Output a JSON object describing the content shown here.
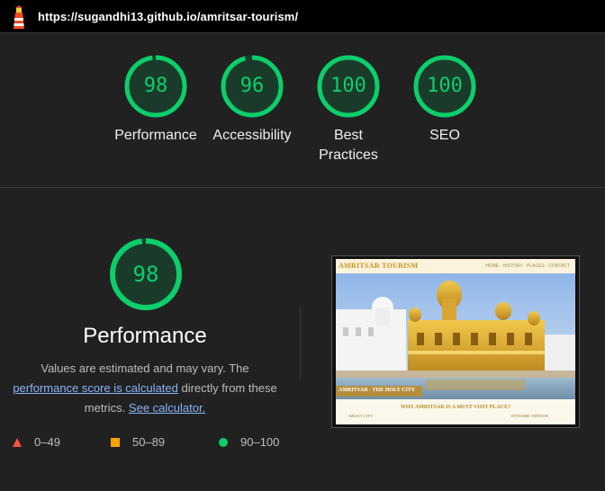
{
  "topbar": {
    "url": "https://sugandhi13.github.io/amritsar-tourism/",
    "logo_icon": "lighthouse-icon"
  },
  "summary": [
    {
      "score": "98",
      "label": "Performance",
      "value": 98
    },
    {
      "score": "96",
      "label": "Accessibility",
      "value": 96
    },
    {
      "score": "100",
      "label": "Best Practices",
      "value": 100
    },
    {
      "score": "100",
      "label": "SEO",
      "value": 100
    }
  ],
  "performance": {
    "score": "98",
    "value": 98,
    "title": "Performance",
    "desc_pre": "Values are estimated and may vary. The",
    "desc_link": "performance score is calculated",
    "desc_mid": "directly from these",
    "desc_post": "metrics.",
    "calc_link": "See calculator."
  },
  "legend": [
    {
      "range": "0–49",
      "shape": "triangle",
      "color": "#ff4e42"
    },
    {
      "range": "50–89",
      "shape": "square",
      "color": "#ffa400"
    },
    {
      "range": "90–100",
      "shape": "circle",
      "color": "#0cce6b"
    }
  ],
  "screenshot": {
    "brand": "AMRITSAR TOURISM",
    "nav": "HOME · HISTORY · PLACES · CONTACT",
    "strip": "AMRITSAR - THE HOLY CITY",
    "question": "WHY AMRITSAR IS A MUST VISIT PLACE?",
    "foot_left": "ABOUT CITY",
    "foot_right": "DYNAMIC EDITION"
  },
  "colors": {
    "pass": "#0cce6b",
    "pass_bg": "#1b3b2a",
    "background": "#212121"
  }
}
